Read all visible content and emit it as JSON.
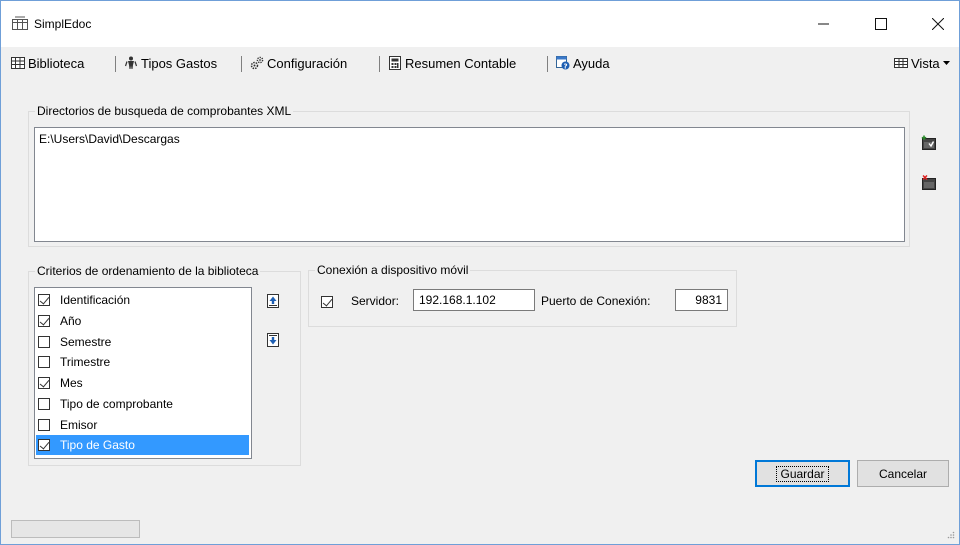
{
  "window": {
    "title": "SimplEdoc"
  },
  "menu": {
    "items": [
      "Biblioteca",
      "Tipos Gastos",
      "Configuración",
      "Resumen Contable",
      "Ayuda"
    ],
    "view": "Vista"
  },
  "directories": {
    "group_title": "Directorios de busqueda de comprobantes XML",
    "paths": [
      "E:\\Users\\David\\Descargas"
    ]
  },
  "criteria": {
    "group_title": "Criterios de ordenamiento de la biblioteca",
    "items": [
      {
        "label": "Identificación",
        "checked": true
      },
      {
        "label": "Año",
        "checked": true
      },
      {
        "label": "Semestre",
        "checked": false
      },
      {
        "label": "Trimestre",
        "checked": false
      },
      {
        "label": "Mes",
        "checked": true
      },
      {
        "label": "Tipo de comprobante",
        "checked": false
      },
      {
        "label": "Emisor",
        "checked": false
      },
      {
        "label": "Tipo de Gasto",
        "checked": true
      }
    ],
    "selected_index": 7
  },
  "connection": {
    "group_title": "Conexión a dispositivo móvil",
    "server_label": "Servidor:",
    "server_checked": true,
    "server_value": "192.168.1.102",
    "port_label": "Puerto de Conexión:",
    "port_value": "9831"
  },
  "buttons": {
    "save": "Guardar",
    "cancel": "Cancelar"
  },
  "colors": {
    "selection": "#3399ff",
    "default_button_border": "#0078d7"
  }
}
